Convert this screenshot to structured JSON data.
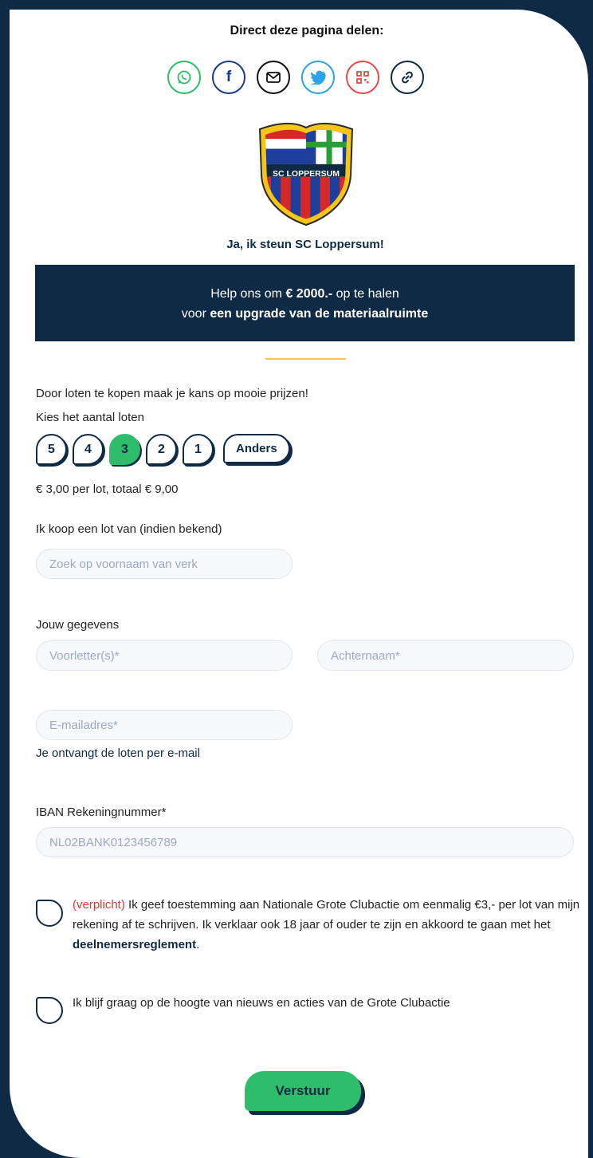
{
  "share": {
    "title": "Direct deze pagina delen:",
    "buttons": [
      {
        "icon": "whatsapp-icon",
        "color": "#2ebd6b"
      },
      {
        "icon": "facebook-icon",
        "color": "#1a3a8a"
      },
      {
        "icon": "email-icon",
        "color": "#111111"
      },
      {
        "icon": "twitter-icon",
        "color": "#2aa3e8"
      },
      {
        "icon": "qr-code-icon",
        "color": "#e34b4b"
      },
      {
        "icon": "link-icon",
        "color": "#0f2a44"
      }
    ]
  },
  "logo": {
    "text": "SC LOPPERSUM"
  },
  "tagline": "Ja, ik steun SC Loppersum!",
  "banner": {
    "line1_prefix": "Help ons om ",
    "amount": "€ 2000.-",
    "line1_suffix": " op te halen",
    "line2_prefix": "voor ",
    "goal": "een upgrade van de materiaalruimte"
  },
  "intro": "Door loten te kopen maak je kans op mooie prijzen!",
  "qty_label": "Kies het aantal loten",
  "quantities": [
    "5",
    "4",
    "3",
    "2",
    "1"
  ],
  "selected_quantity": "3",
  "other_label": "Anders",
  "price_text": "€ 3,00 per lot, totaal € 9,00",
  "seller": {
    "label": "Ik koop een lot van (indien bekend)",
    "placeholder": "Zoek op voornaam van verk"
  },
  "details": {
    "label": "Jouw gegevens",
    "initials_placeholder": "Voorletter(s)*",
    "lastname_placeholder": "Achternaam*",
    "email_placeholder": "E-mailadres*",
    "email_note": "Je ontvangt de loten per e-mail"
  },
  "iban": {
    "label": "IBAN Rekeningnummer*",
    "placeholder": "NL02BANK0123456789"
  },
  "consent": {
    "required_tag": "(verplicht)",
    "text": " Ik geef toestemming aan Nationale Grote Clubactie om eenmalig €3,- per lot van mijn rekening af te schrijven. Ik verklaar ook 18 jaar of ouder te zijn en akkoord te gaan met het ",
    "link": "deelnemersreglement",
    "end": "."
  },
  "newsletter": "Ik blijf graag op de hoogte van nieuws en acties van de Grote Clubactie",
  "submit_label": "Verstuur"
}
